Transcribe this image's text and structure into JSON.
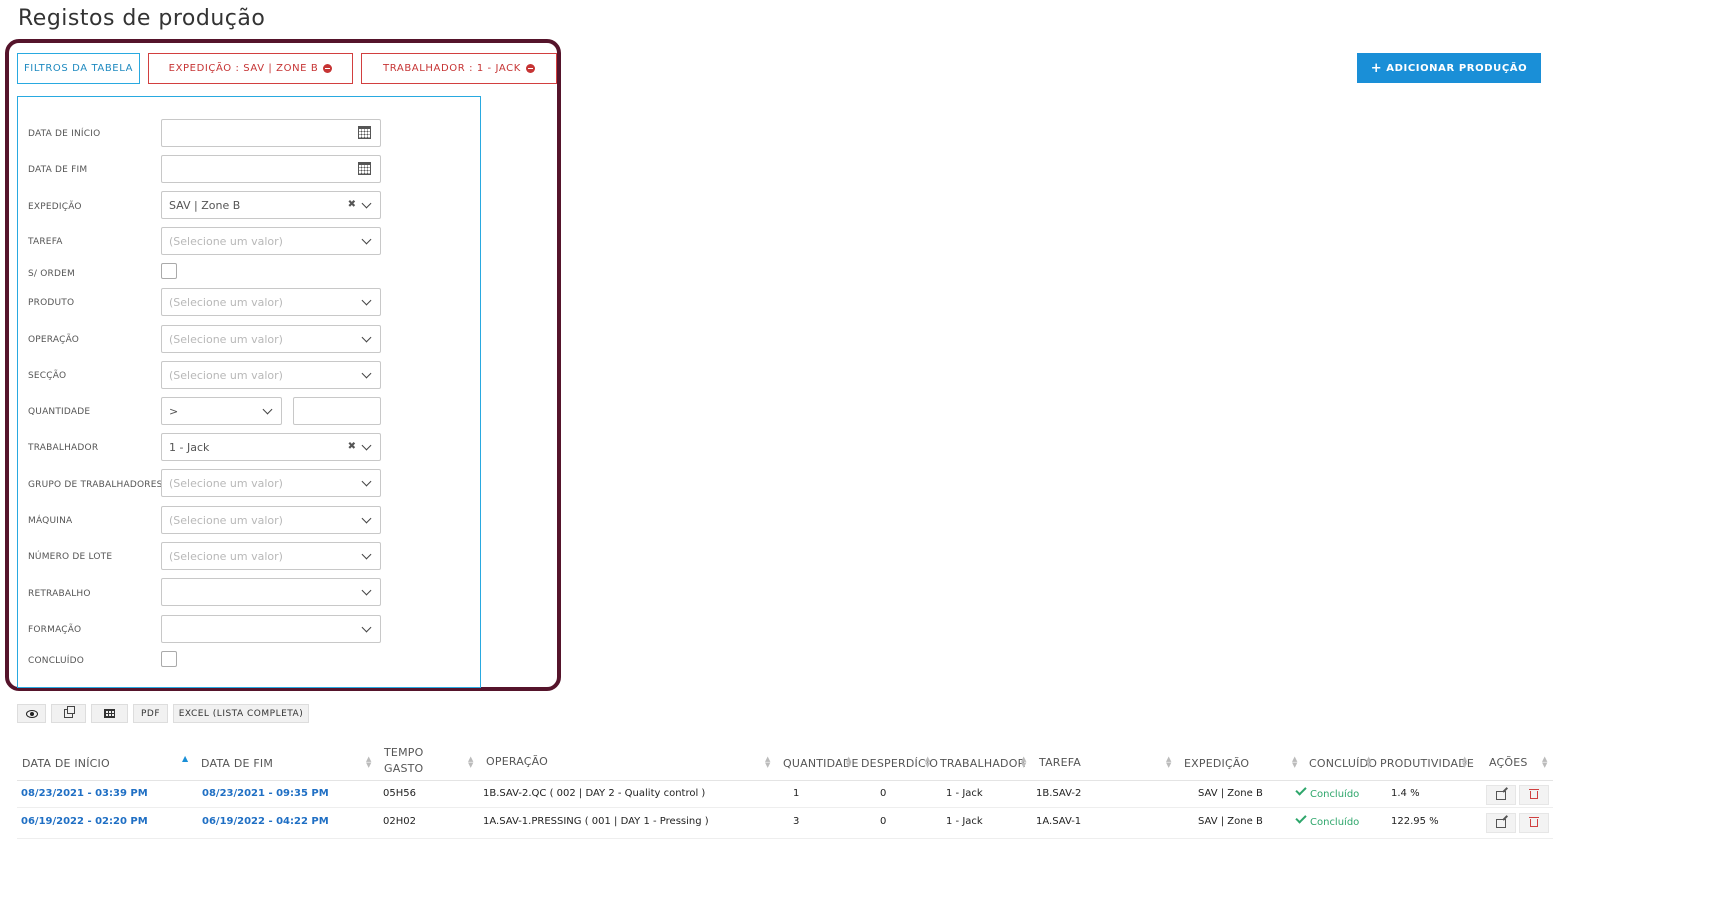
{
  "page": {
    "title": "Registos de produção"
  },
  "filter_chips": {
    "table_filters": "FILTROS DA TABELA",
    "expedition": "EXPEDIÇÃO : SAV | ZONE B",
    "worker": "TRABALHADOR : 1 - JACK"
  },
  "add_button": {
    "label": "ADICIONAR PRODUÇÃO"
  },
  "filters": {
    "start_date": {
      "label": "DATA DE INÍCIO",
      "value": ""
    },
    "end_date": {
      "label": "DATA DE FIM",
      "value": ""
    },
    "expedition": {
      "label": "EXPEDIÇÃO",
      "value": "SAV | Zone B"
    },
    "task": {
      "label": "TAREFA",
      "placeholder": "(Selecione um valor)"
    },
    "no_order": {
      "label": "S/ ORDEM",
      "checked": false
    },
    "product": {
      "label": "PRODUTO",
      "placeholder": "(Selecione um valor)"
    },
    "operation": {
      "label": "OPERAÇÃO",
      "placeholder": "(Selecione um valor)"
    },
    "section": {
      "label": "SECÇÃO",
      "placeholder": "(Selecione um valor)"
    },
    "quantity": {
      "label": "QUANTIDADE",
      "operator": ">",
      "value": ""
    },
    "worker": {
      "label": "TRABALHADOR",
      "value": "1 - Jack"
    },
    "worker_group": {
      "label": "GRUPO DE TRABALHADORES",
      "placeholder": "(Selecione um valor)"
    },
    "machine": {
      "label": "MÁQUINA",
      "placeholder": "(Selecione um valor)"
    },
    "lot_number": {
      "label": "NÚMERO DE LOTE",
      "placeholder": "(Selecione um valor)"
    },
    "rework": {
      "label": "RETRABALHO",
      "value": ""
    },
    "training": {
      "label": "FORMAÇÃO",
      "value": ""
    },
    "completed": {
      "label": "CONCLUÍDO",
      "checked": false
    }
  },
  "toolbar": {
    "view_icon": "eye-icon",
    "copy_icon": "copy-icon",
    "columns_icon": "table-icon",
    "pdf": "PDF",
    "excel": "EXCEL (LISTA COMPLETA)"
  },
  "table": {
    "headers": {
      "start_date": "DATA DE INÍCIO",
      "end_date": "DATA DE FIM",
      "time_spent_1": "TEMPO",
      "time_spent_2": "GASTO",
      "operation": "OPERAÇÃO",
      "quantity": "QUANTIDADE",
      "waste": "DESPERDÍCIO",
      "worker": "TRABALHADOR",
      "task": "TAREFA",
      "expedition": "EXPEDIÇÃO",
      "completed": "CONCLUÍDO",
      "productivity": "PRODUTIVIDADE",
      "actions": "AÇÕES"
    },
    "rows": [
      {
        "start_date": "08/23/2021 - 03:39 PM",
        "end_date": "08/23/2021 - 09:35 PM",
        "time_spent": "05H56",
        "operation": "1B.SAV-2.QC ( 002 | DAY 2 - Quality control )",
        "quantity": "1",
        "waste": "0",
        "worker": "1 - Jack",
        "task": "1B.SAV-2",
        "expedition": "SAV | Zone B",
        "completed": "Concluído",
        "productivity": "1.4 %"
      },
      {
        "start_date": "06/19/2022 - 02:20 PM",
        "end_date": "06/19/2022 - 04:22 PM",
        "time_spent": "02H02",
        "operation": "1A.SAV-1.PRESSING ( 001 | DAY 1 - Pressing )",
        "quantity": "3",
        "waste": "0",
        "worker": "1 - Jack",
        "task": "1A.SAV-1",
        "expedition": "SAV | Zone B",
        "completed": "Concluído",
        "productivity": "122.95 %"
      }
    ]
  },
  "colors": {
    "accent": "#1a8fd7",
    "active_filter": "#c63434",
    "highlight_frame": "#55142b",
    "success": "#2ea66b"
  }
}
